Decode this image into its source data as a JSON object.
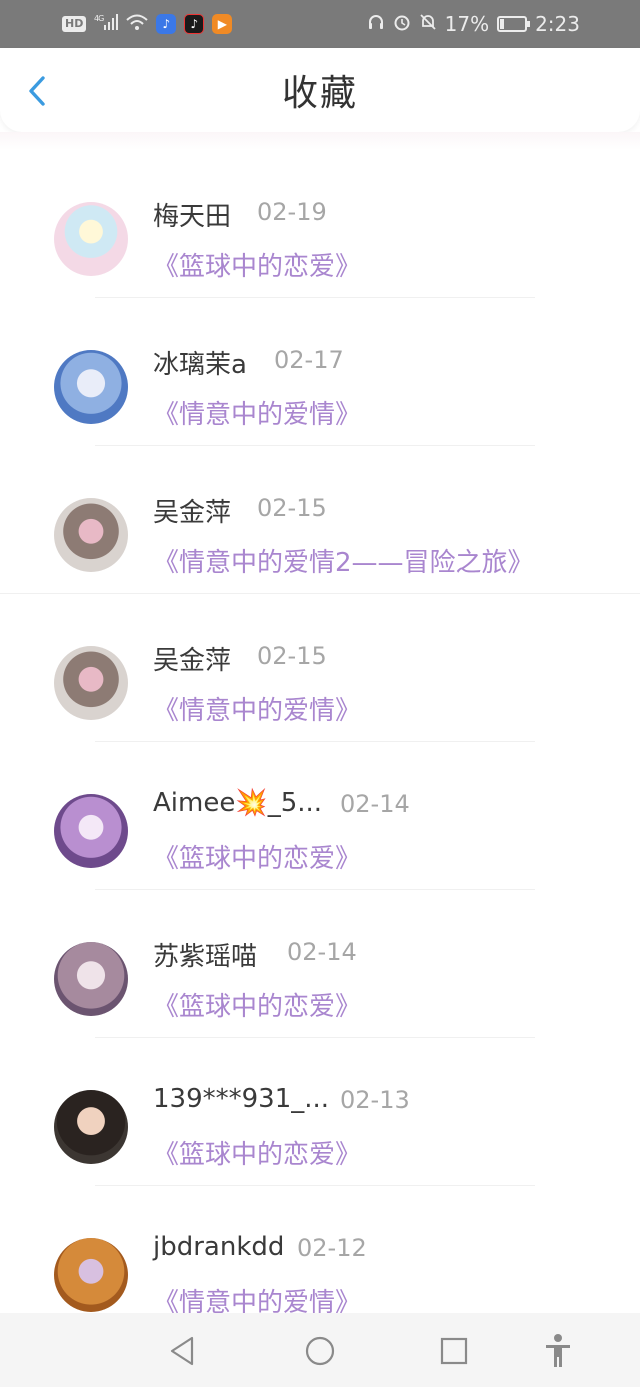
{
  "status_bar": {
    "left_indicators": [
      "HD",
      "4G"
    ],
    "battery_percent": "17%",
    "time": "2:23",
    "battery_level": 0.17
  },
  "header": {
    "title": "收藏",
    "accent_color": "#3b9be0"
  },
  "favorites": [
    {
      "name": "梅天田",
      "date": "02-19",
      "book": "《篮球中的恋爱》",
      "avatar_icon": "anime-girl-avatar"
    },
    {
      "name": "冰璃茉a",
      "date": "02-17",
      "book": "《情意中的爱情》",
      "avatar_icon": "anime-girl-avatar"
    },
    {
      "name": "吴金萍",
      "date": "02-15",
      "book": "《情意中的爱情2——冒险之旅》",
      "avatar_icon": "photo-avatar"
    },
    {
      "name": "吴金萍",
      "date": "02-15",
      "book": "《情意中的爱情》",
      "avatar_icon": "photo-avatar"
    },
    {
      "name": "Aimee💥_5...",
      "date": "02-14",
      "book": "《篮球中的恋爱》",
      "avatar_icon": "anime-girl-avatar"
    },
    {
      "name": "苏紫瑶喵",
      "date": "02-14",
      "book": "《篮球中的恋爱》",
      "avatar_icon": "anime-girl-avatar"
    },
    {
      "name": "139***931_...",
      "date": "02-13",
      "book": "《篮球中的恋爱》",
      "avatar_icon": "photo-avatar"
    },
    {
      "name": "jbdrankdd",
      "date": "02-12",
      "book": "《情意中的爱情》",
      "avatar_icon": "photo-avatar"
    }
  ],
  "colors": {
    "book_title": "#a986cf",
    "name": "#3a3a3a",
    "date": "#a6a6a6"
  },
  "nav_bar": {
    "icons": [
      "back-triangle-icon",
      "home-circle-icon",
      "recents-square-icon",
      "accessibility-icon"
    ]
  }
}
